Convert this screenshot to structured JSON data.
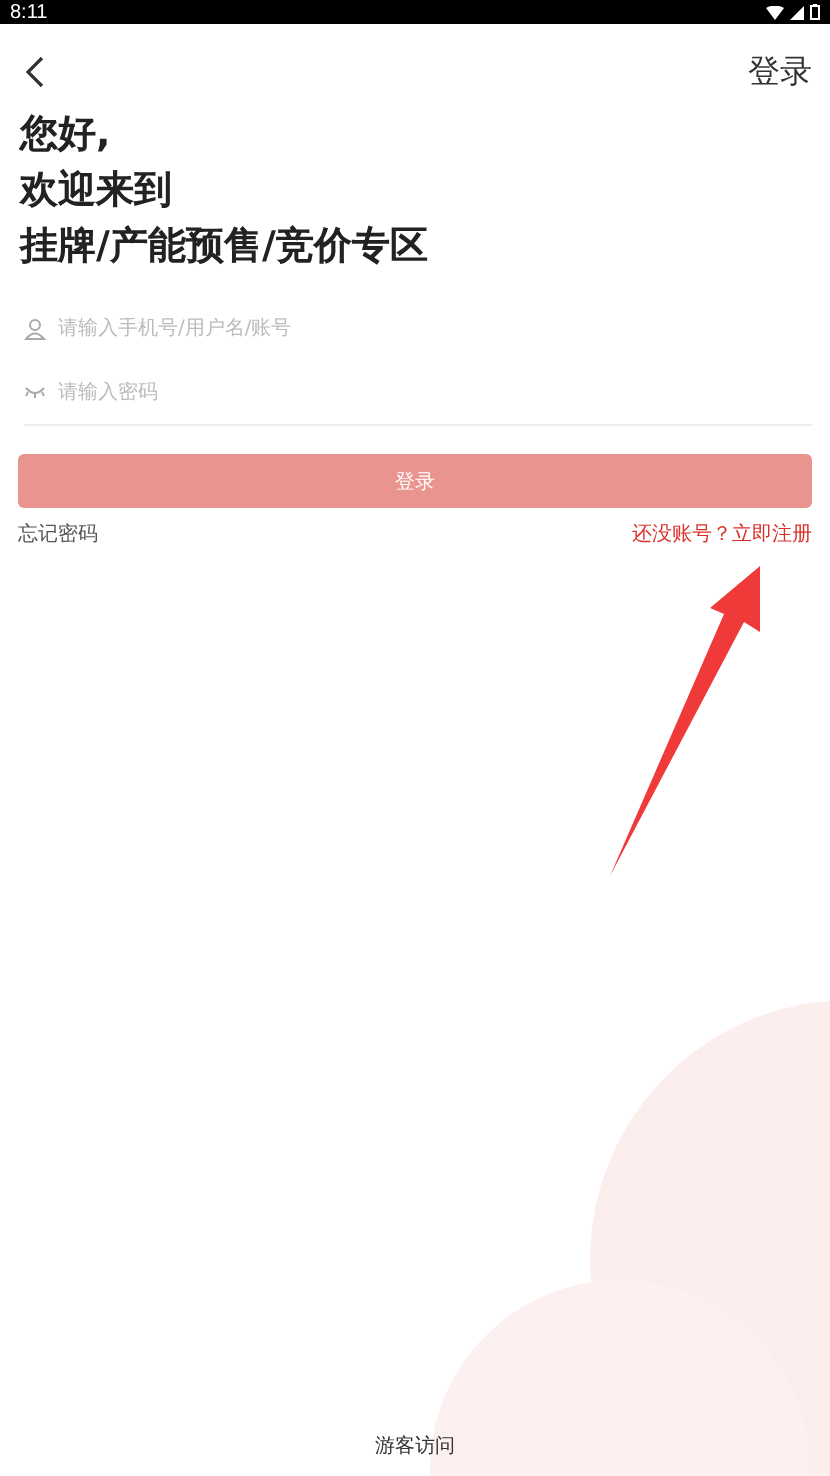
{
  "status_bar": {
    "time": "8:11"
  },
  "nav": {
    "action": "登录"
  },
  "greeting": [
    "您好,",
    "欢迎来到",
    "挂牌/产能预售/竞价专区"
  ],
  "fields": [
    {
      "kind": "user",
      "placeholder": "请输入手机号/用户名/账号"
    },
    {
      "kind": "password",
      "placeholder": "请输入密码"
    }
  ],
  "login_button": "登录",
  "forgot_link": "忘记密码",
  "register_link": "还没账号？立即注册",
  "guest_link": "游客访问"
}
